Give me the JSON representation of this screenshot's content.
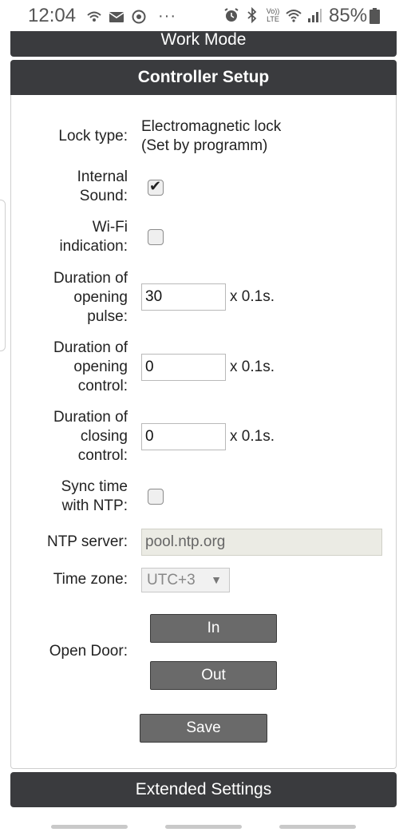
{
  "status_bar": {
    "time": "12:04",
    "battery_percent": "85%",
    "icons_left": [
      "wifi-call-icon",
      "mail-icon",
      "sync-icon",
      "more-dots-icon"
    ],
    "icons_right": [
      "alarm-icon",
      "bluetooth-icon",
      "volte-icon",
      "wifi-icon",
      "signal-icon",
      "battery-icon"
    ],
    "more_dots": "···",
    "volte_label": "Vo)) LTE"
  },
  "header": {
    "work_mode": "Work Mode",
    "controller_setup": "Controller Setup",
    "extended_settings": "Extended Settings"
  },
  "form": {
    "lock_type": {
      "label": "Lock type:",
      "value_line1": "Electromagnetic lock",
      "value_line2": "(Set by programm)"
    },
    "internal_sound": {
      "label_line1": "Internal",
      "label_line2": "Sound:",
      "checked": true
    },
    "wifi_indication": {
      "label_line1": "Wi-Fi",
      "label_line2": "indication:",
      "checked": false
    },
    "opening_pulse": {
      "label_line1": "Duration of",
      "label_line2": "opening",
      "label_line3": "pulse:",
      "value": "30",
      "unit": "x 0.1s."
    },
    "opening_control": {
      "label_line1": "Duration of",
      "label_line2": "opening",
      "label_line3": "control:",
      "value": "0",
      "unit": "x 0.1s."
    },
    "closing_control": {
      "label_line1": "Duration of",
      "label_line2": "closing",
      "label_line3": "control:",
      "value": "0",
      "unit": "x 0.1s."
    },
    "sync_ntp": {
      "label_line1": "Sync time",
      "label_line2": "with NTP:",
      "checked": false
    },
    "ntp_server": {
      "label": "NTP server:",
      "value": "pool.ntp.org"
    },
    "time_zone": {
      "label": "Time zone:",
      "selected": "UTC+3",
      "arrow": "▼"
    },
    "open_door": {
      "label": "Open Door:",
      "in_label": "In",
      "out_label": "Out"
    },
    "save_label": "Save",
    "checkmark": "✔"
  },
  "colors": {
    "header_bg": "#3a3b3e",
    "button_bg": "#6a6a6a",
    "disabled_input_bg": "#ebebe4"
  }
}
